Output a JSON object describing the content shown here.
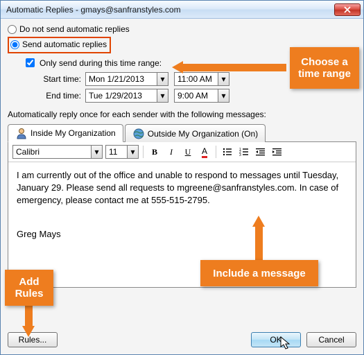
{
  "title": "Automatic Replies - gmays@sanfranstyles.com",
  "radios": {
    "no_send": "Do not send automatic replies",
    "send": "Send automatic replies"
  },
  "only_send": "Only send during this time range:",
  "labels": {
    "start": "Start time:",
    "end": "End time:"
  },
  "times": {
    "start_date": "Mon 1/21/2013",
    "start_time": "11:00 AM",
    "end_date": "Tue 1/29/2013",
    "end_time": "9:00 AM"
  },
  "descr": "Automatically reply once for each sender with the following messages:",
  "tabs": {
    "inside": "Inside My Organization",
    "outside": "Outside My Organization (On)"
  },
  "toolbar": {
    "font": "Calibri",
    "size": "11"
  },
  "icons": {
    "bold": "B",
    "italic": "I",
    "underline": "U",
    "fontcolor": "A"
  },
  "message": {
    "body": "I am currently out of the office and unable to respond to messages until Tuesday, January 29. Please send all requests to mgreene@sanfranstyles.com. In case of emergency, please contact me at 555-515-2795.",
    "signature": "Greg Mays"
  },
  "buttons": {
    "rules": "Rules...",
    "ok": "OK",
    "cancel": "Cancel"
  },
  "callouts": {
    "time": "Choose a time range",
    "rules": "Add Rules",
    "msg": "Include a message"
  }
}
